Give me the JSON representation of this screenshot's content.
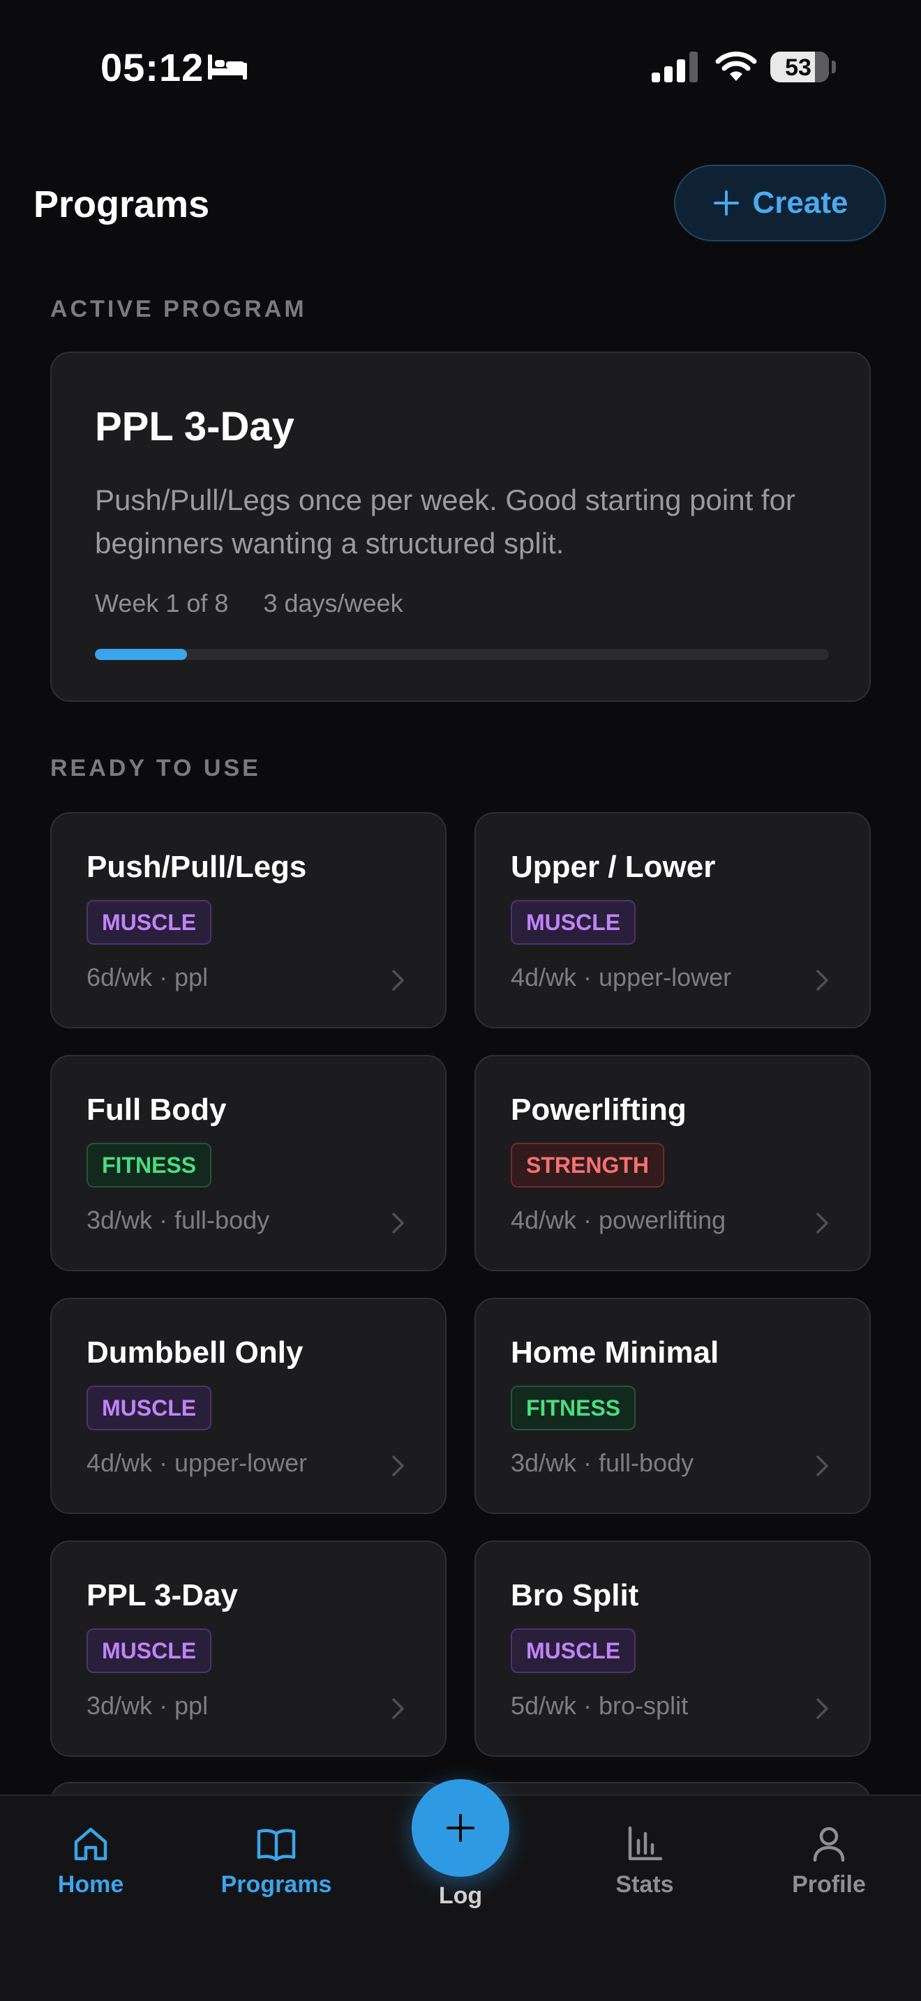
{
  "status_bar": {
    "time": "05:12",
    "battery": "53",
    "icons": [
      "bed-icon",
      "cellular-signal-icon",
      "wifi-icon",
      "battery-icon"
    ]
  },
  "header": {
    "title": "Programs",
    "create_label": "Create"
  },
  "active_section": {
    "label": "ACTIVE PROGRAM",
    "program": {
      "title": "PPL 3-Day",
      "description": "Push/Pull/Legs once per week. Good starting point for beginners wanting a structured split.",
      "week": "Week 1 of 8",
      "frequency": "3 days/week",
      "progress": 0.125
    }
  },
  "ready_section": {
    "label": "READY TO USE",
    "programs": [
      {
        "name": "Push/Pull/Legs",
        "category": "MUSCLE",
        "meta": "6d/wk · ppl"
      },
      {
        "name": "Upper / Lower",
        "category": "MUSCLE",
        "meta": "4d/wk · upper-lower"
      },
      {
        "name": "Full Body",
        "category": "FITNESS",
        "meta": "3d/wk · full-body"
      },
      {
        "name": "Powerlifting",
        "category": "STRENGTH",
        "meta": "4d/wk · powerlifting"
      },
      {
        "name": "Dumbbell Only",
        "category": "MUSCLE",
        "meta": "4d/wk · upper-lower"
      },
      {
        "name": "Home Minimal",
        "category": "FITNESS",
        "meta": "3d/wk · full-body"
      },
      {
        "name": "PPL 3-Day",
        "category": "MUSCLE",
        "meta": "3d/wk · ppl"
      },
      {
        "name": "Bro Split",
        "category": "MUSCLE",
        "meta": "5d/wk · bro-split"
      }
    ]
  },
  "tab_bar": {
    "home": "Home",
    "programs": "Programs",
    "log": "Log",
    "stats": "Stats",
    "profile": "Profile",
    "active_tab": "programs"
  },
  "colors": {
    "accent": "#3aa5ec",
    "background": "#0b0b0d",
    "card": "#1c1c1f",
    "muscle": "#c084fc",
    "fitness": "#4ade80",
    "strength": "#f87171"
  }
}
